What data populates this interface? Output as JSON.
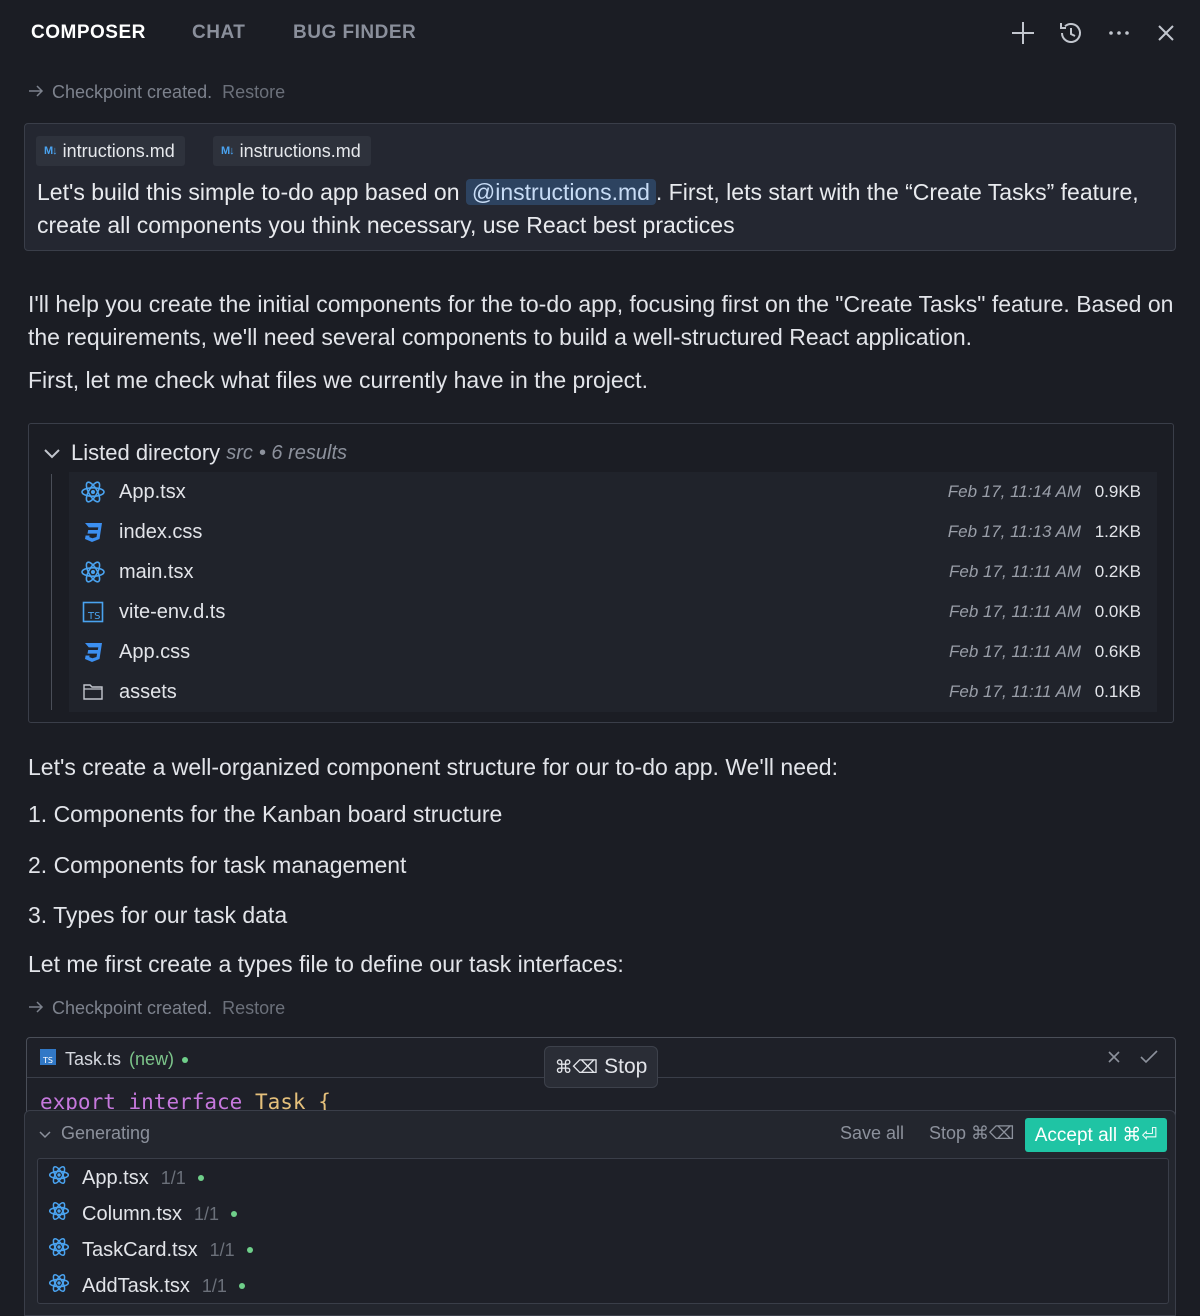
{
  "header": {
    "tabs": [
      {
        "label": "COMPOSER",
        "active": true
      },
      {
        "label": "CHAT",
        "active": false
      },
      {
        "label": "BUG FINDER",
        "active": false
      }
    ],
    "icons": [
      "plus-icon",
      "history-icon",
      "more-icon",
      "close-icon"
    ]
  },
  "checkpoint_1": {
    "text": "Checkpoint created.",
    "restore": "Restore"
  },
  "user_message": {
    "chips": [
      "intructions.md",
      "instructions.md"
    ],
    "text_before": "Let's build this simple to-do app based on ",
    "mention": "@instructions.md",
    "text_after": ". First, lets start with the “Create Tasks” feature, create all components you think necessary, use React best practices"
  },
  "assistant": {
    "para1": "I'll help you create the initial components for the to-do app, focusing first on the \"Create Tasks\" feature. Based on the requirements, we'll need several components to build a well-structured React application.",
    "para2": "First, let me check what files we currently have in the project.",
    "para3": "Let's create a well-organized component structure for our to-do app. We'll need:",
    "list": [
      "1. Components for the Kanban board structure",
      "2. Components for task management",
      "3. Types for our task data"
    ],
    "para4": "Let me first create a types file to define our task interfaces:"
  },
  "directory": {
    "label": "Listed directory",
    "path": "src",
    "count": "• 6 results",
    "files": [
      {
        "name": "App.tsx",
        "date": "Feb 17, 11:14 AM",
        "size": "0.9KB",
        "icon": "react-icon"
      },
      {
        "name": "index.css",
        "date": "Feb 17, 11:13 AM",
        "size": "1.2KB",
        "icon": "css-icon"
      },
      {
        "name": "main.tsx",
        "date": "Feb 17, 11:11 AM",
        "size": "0.2KB",
        "icon": "react-icon"
      },
      {
        "name": "vite-env.d.ts",
        "date": "Feb 17, 11:11 AM",
        "size": "0.0KB",
        "icon": "ts-icon"
      },
      {
        "name": "App.css",
        "date": "Feb 17, 11:11 AM",
        "size": "0.6KB",
        "icon": "css-icon"
      },
      {
        "name": "assets",
        "date": "Feb 17, 11:11 AM",
        "size": "0.1KB",
        "icon": "folder-icon"
      }
    ]
  },
  "checkpoint_2": {
    "text": "Checkpoint created.",
    "restore": "Restore"
  },
  "editor": {
    "filename": "Task.ts",
    "status": "(new)",
    "code": {
      "kw1": "export",
      "kw2": "interface",
      "type": "Task",
      "brace": "{"
    }
  },
  "stop_pill": {
    "keys": "⌘⌫",
    "label": "Stop"
  },
  "generating": {
    "label": "Generating",
    "save_all": "Save all",
    "stop": "Stop ⌘⌫",
    "accept_all": "Accept all ⌘⏎",
    "files": [
      {
        "name": "App.tsx",
        "count": "1/1"
      },
      {
        "name": "Column.tsx",
        "count": "1/1"
      },
      {
        "name": "TaskCard.tsx",
        "count": "1/1"
      },
      {
        "name": "AddTask.tsx",
        "count": "1/1"
      }
    ]
  },
  "colors": {
    "accent": "#1fc4a4",
    "background": "#1b1d24",
    "mention_bg": "#2d4360"
  }
}
